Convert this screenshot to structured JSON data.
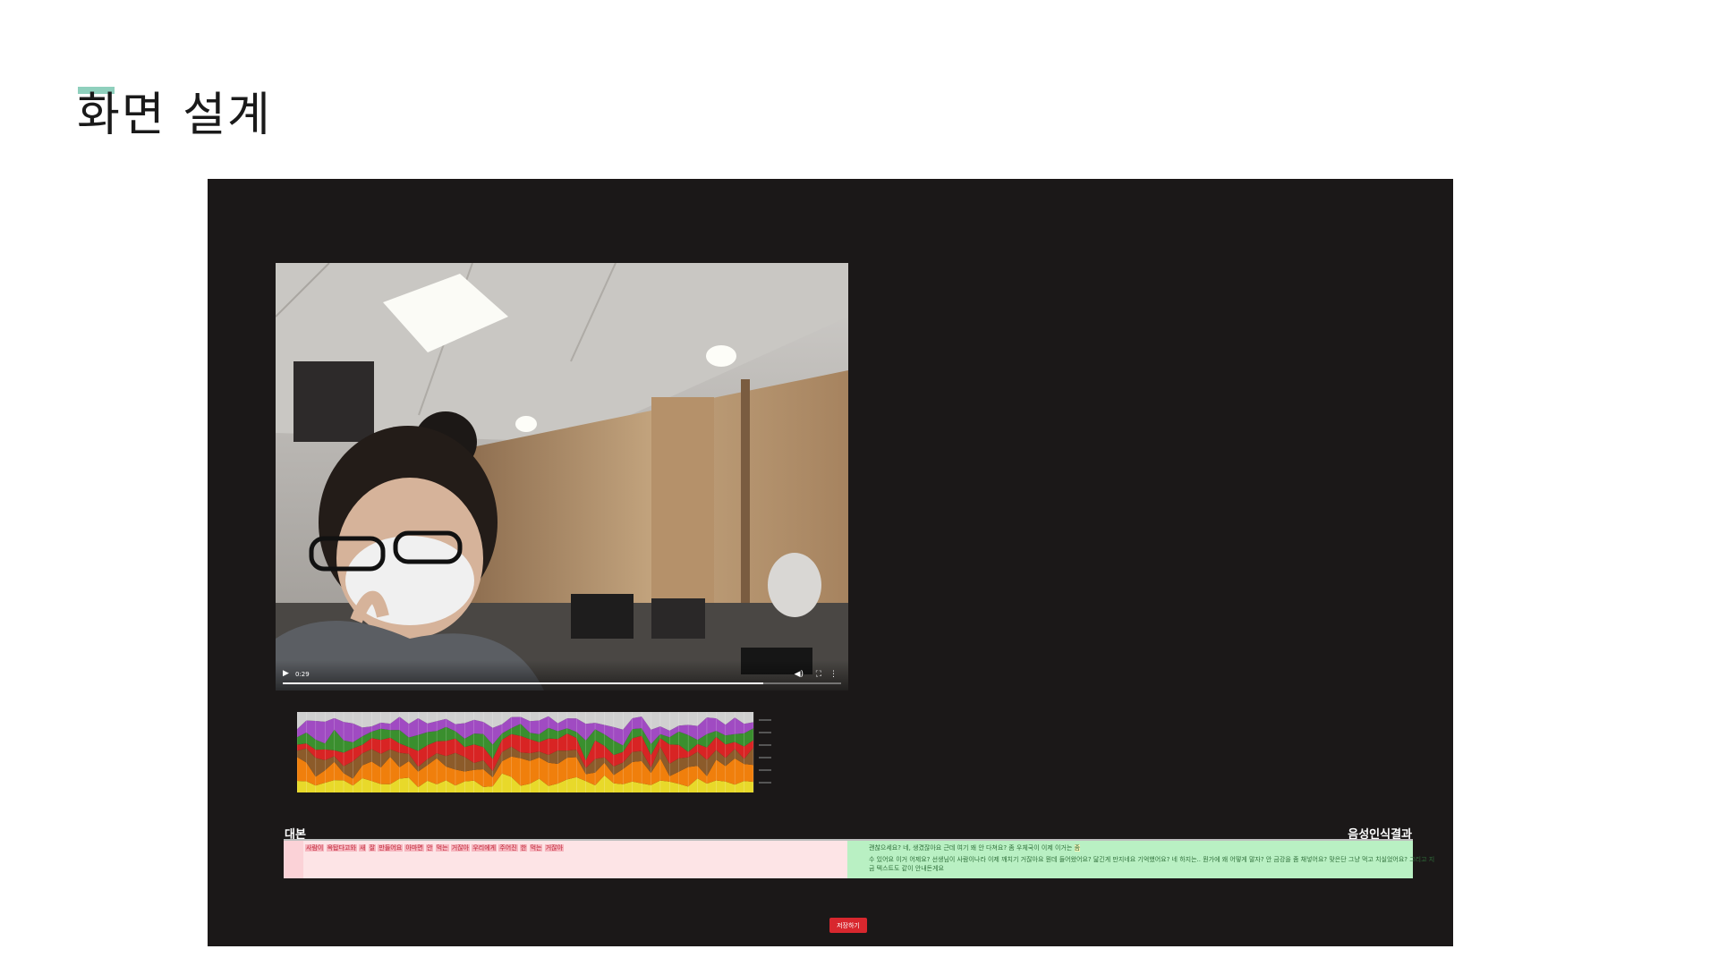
{
  "slide": {
    "title": "화면 설계",
    "accent_color": "#8fd0bd"
  },
  "video": {
    "time": "0:29",
    "progress": 0.86,
    "icons": [
      "play-icon",
      "volume-icon",
      "fullscreen-icon",
      "more-options-icon"
    ]
  },
  "chart_data": {
    "type": "area",
    "stacked": true,
    "colors": [
      "#e8d92a",
      "#f07f0c",
      "#8c5b2a",
      "#d82424",
      "#3a8f2e",
      "#a04bc2",
      "#d0d0d0"
    ],
    "grid": true
  },
  "panels": {
    "script_label": "대본",
    "result_label": "음성인식결과",
    "script_words": [
      "사람이",
      "옥탑다고와",
      "새",
      "잘",
      "만들어요",
      "아마면",
      "안",
      "먹는",
      "거잖아",
      "우리에게",
      "주어진",
      "한",
      "먹는",
      "거잖아"
    ],
    "result_line1": "괜찮으세요? 네, 생겼잖아요 근데 여기 왜 안 다쳐요? 좀 우체국이 이제 이거는",
    "result_line1_highlight": "좀",
    "result_line2": "수 있어요 이거 어제요? 선생님이 사람이나라 이제 깨치기 거잖아요 뭔데 들어왔어요? 닮긴게 만지네요 기억했어요? 네 하지는.. 뭔가에 왜 어떻게 말자? 안 금강을 좀 채넣어요? 맞은단 그냥 먹고 치실었어요? 그리고 지",
    "result_line3": "금 텍스트도 같이 안내돈게요"
  },
  "save_button": {
    "label": "저장하기",
    "color": "#d8272e"
  }
}
